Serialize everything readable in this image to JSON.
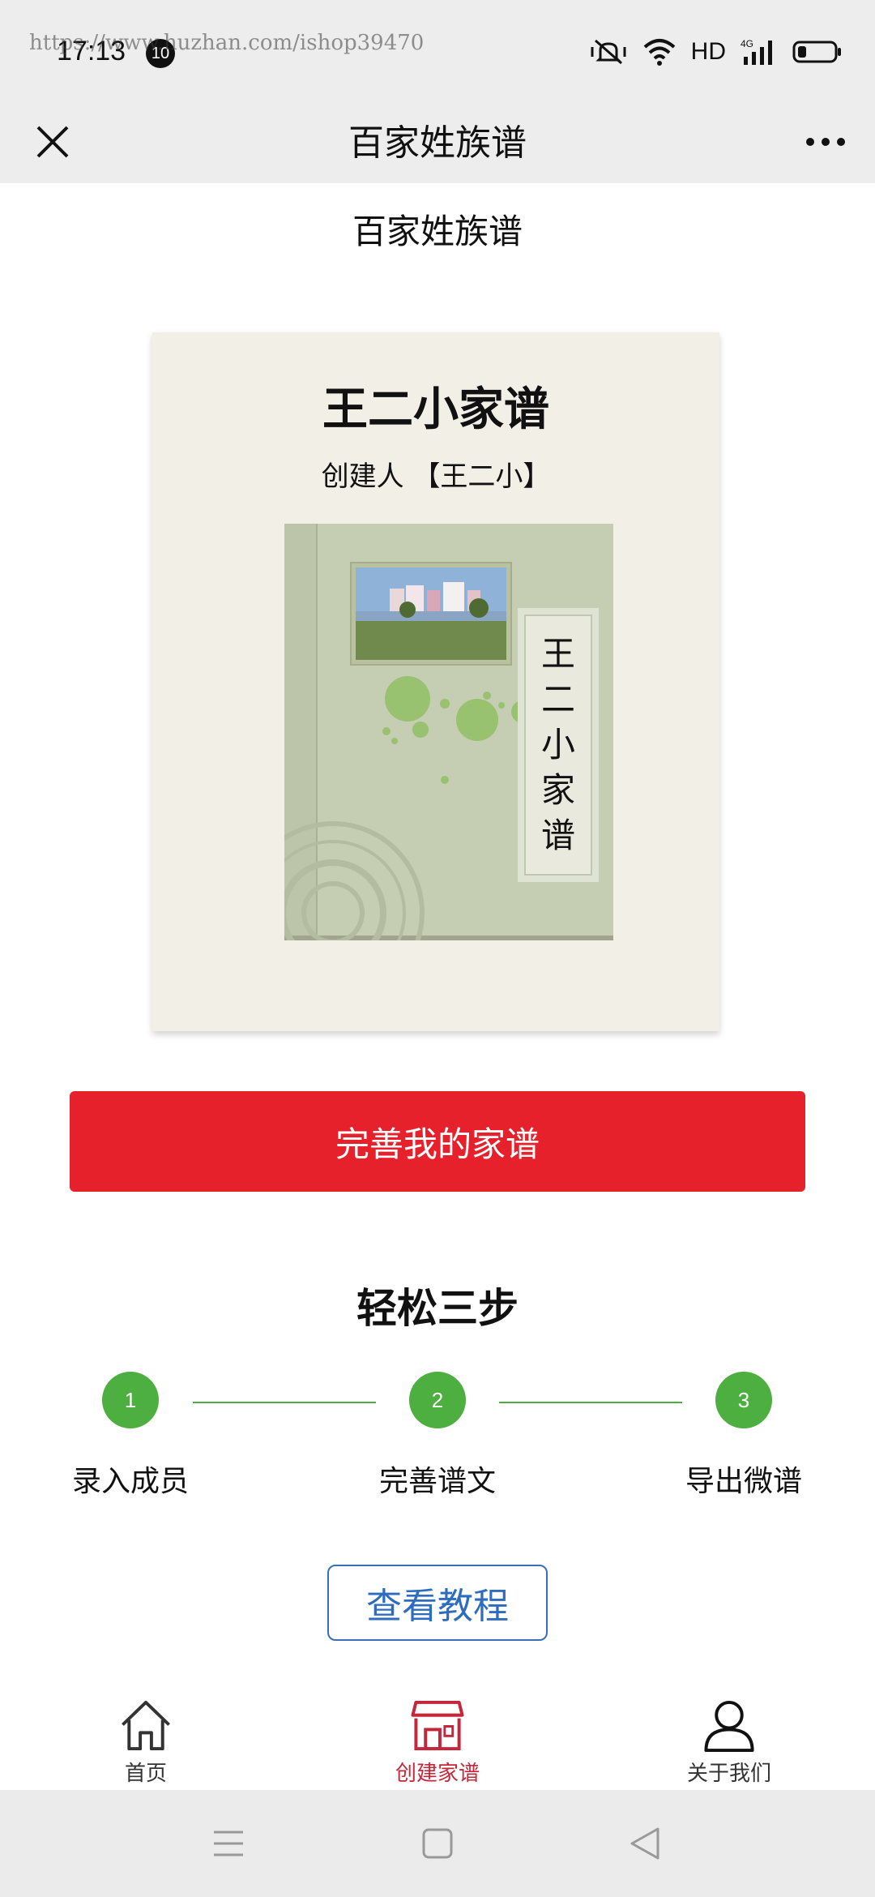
{
  "status_bar": {
    "time": "17:13",
    "notification_count": "10",
    "watermark": "https://www.huzhan.com/ishop39470",
    "hd": "HD",
    "network": "4G"
  },
  "nav": {
    "title": "百家姓族谱"
  },
  "page": {
    "heading": "百家姓族谱"
  },
  "card": {
    "title": "王二小家谱",
    "creator": "创建人 【王二小】",
    "book_label_chars": [
      "王",
      "二",
      "小",
      "家",
      "谱"
    ]
  },
  "primary_button": {
    "label": "完善我的家谱"
  },
  "steps": {
    "title": "轻松三步",
    "items": [
      {
        "number": "1",
        "label": "录入成员"
      },
      {
        "number": "2",
        "label": "完善谱文"
      },
      {
        "number": "3",
        "label": "导出微谱"
      }
    ]
  },
  "tutorial_button": {
    "label": "查看教程"
  },
  "tab_bar": {
    "items": [
      {
        "label": "首页",
        "icon": "home-icon"
      },
      {
        "label": "创建家谱",
        "icon": "store-icon",
        "active": true
      },
      {
        "label": "关于我们",
        "icon": "user-icon"
      }
    ]
  },
  "colors": {
    "primary_red": "#e6212c",
    "step_green": "#4caf3f",
    "link_blue": "#2e6cc0",
    "active_tab": "#c6263a",
    "inactive_tab": "#333333"
  }
}
